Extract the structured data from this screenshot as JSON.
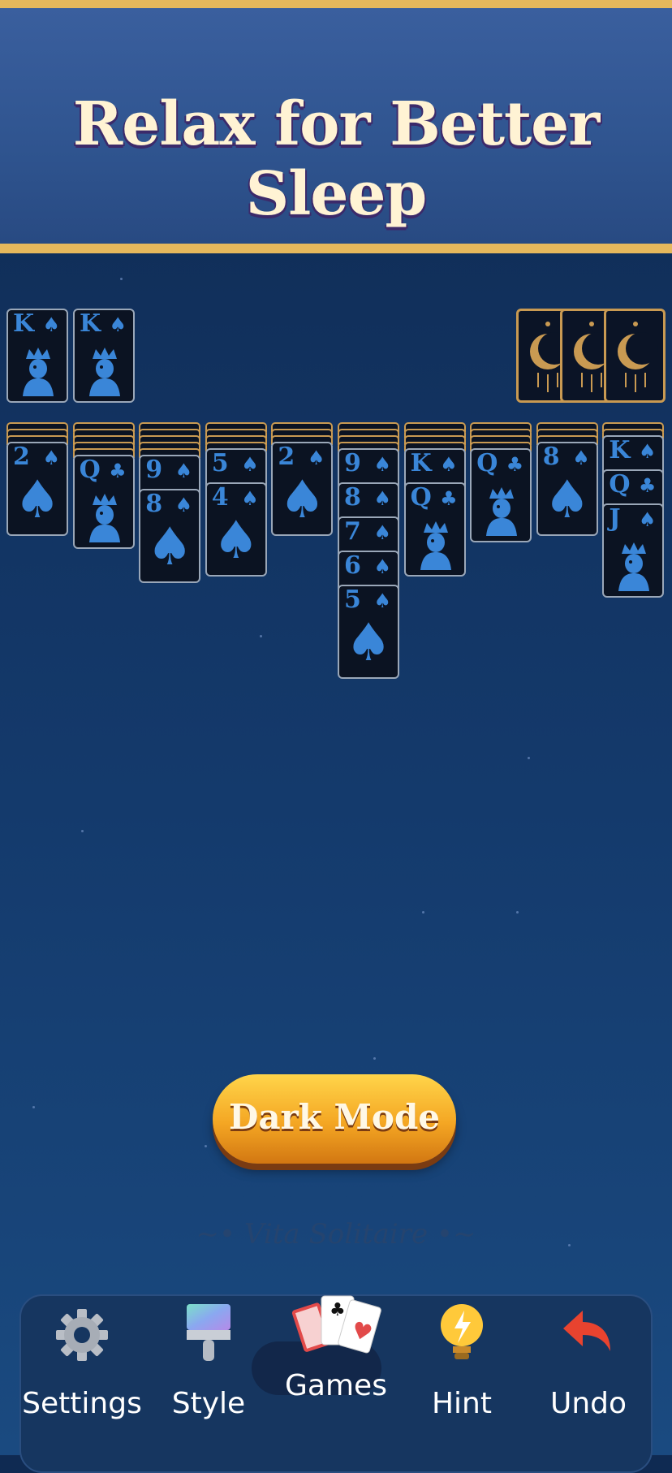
{
  "banner": {
    "title": "Relax for Better Sleep"
  },
  "foundations": [
    {
      "rank": "K",
      "suit": "♠"
    },
    {
      "rank": "K",
      "suit": "♠"
    }
  ],
  "tableau": [
    {
      "hidden": 3,
      "cards": [
        {
          "rank": "2",
          "suit": "♠",
          "kind": "pip"
        }
      ]
    },
    {
      "hidden": 5,
      "cards": [
        {
          "rank": "Q",
          "suit": "♣",
          "kind": "face"
        }
      ]
    },
    {
      "hidden": 5,
      "cards": [
        {
          "rank": "9",
          "suit": "♠",
          "kind": "pip"
        },
        {
          "rank": "8",
          "suit": "♠",
          "kind": "pip"
        }
      ]
    },
    {
      "hidden": 4,
      "cards": [
        {
          "rank": "5",
          "suit": "♠",
          "kind": "pip"
        },
        {
          "rank": "4",
          "suit": "♠",
          "kind": "pip"
        }
      ]
    },
    {
      "hidden": 3,
      "cards": [
        {
          "rank": "2",
          "suit": "♠",
          "kind": "pip"
        }
      ]
    },
    {
      "hidden": 4,
      "cards": [
        {
          "rank": "9",
          "suit": "♠",
          "kind": "pip"
        },
        {
          "rank": "8",
          "suit": "♠",
          "kind": "pip"
        },
        {
          "rank": "7",
          "suit": "♠",
          "kind": "pip"
        },
        {
          "rank": "6",
          "suit": "♠",
          "kind": "pip"
        },
        {
          "rank": "5",
          "suit": "♠",
          "kind": "pip"
        }
      ]
    },
    {
      "hidden": 4,
      "cards": [
        {
          "rank": "K",
          "suit": "♠",
          "kind": "pip"
        },
        {
          "rank": "Q",
          "suit": "♣",
          "kind": "face"
        }
      ]
    },
    {
      "hidden": 4,
      "cards": [
        {
          "rank": "Q",
          "suit": "♣",
          "kind": "face"
        }
      ]
    },
    {
      "hidden": 3,
      "cards": [
        {
          "rank": "8",
          "suit": "♠",
          "kind": "pip"
        }
      ]
    },
    {
      "hidden": 2,
      "cards": [
        {
          "rank": "K",
          "suit": "♠",
          "kind": "pip"
        },
        {
          "rank": "Q",
          "suit": "♣",
          "kind": "pip"
        },
        {
          "rank": "J",
          "suit": "♠",
          "kind": "face"
        }
      ]
    }
  ],
  "stock": {
    "count": 3
  },
  "dark_mode_button": {
    "label": "Dark Mode"
  },
  "watermark": "~• Vita Solitaire •~",
  "toolbar": {
    "settings": "Settings",
    "style": "Style",
    "games": "Games",
    "hint": "Hint",
    "undo": "Undo"
  },
  "colors": {
    "card_text": "#3a86d8",
    "card_bg": "#0b1322",
    "gold": "#e6b85c",
    "button_orange": "#f4a623"
  }
}
